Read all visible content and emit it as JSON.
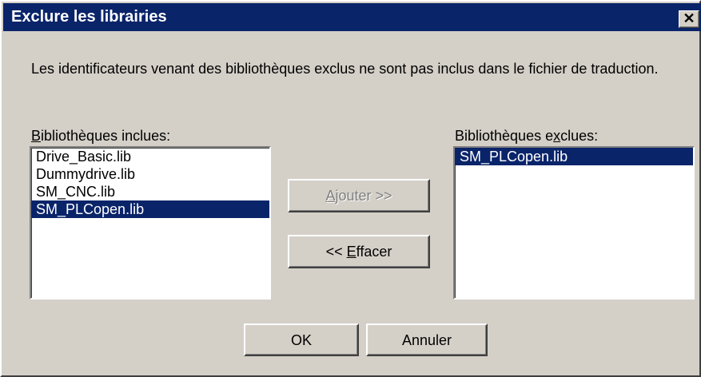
{
  "window": {
    "title": "Exclure les librairies",
    "close_glyph": "✕"
  },
  "description": "Les identificateurs venant des bibliothèques exclus ne sont pas inclus dans le fichier de traduction.",
  "included": {
    "label_prefix": "",
    "label_mnemonic": "B",
    "label_rest": "ibliothèques inclues:",
    "items": [
      "Drive_Basic.lib",
      "Dummydrive.lib",
      "SM_CNC.lib",
      "SM_PLCopen.lib"
    ],
    "selected": "SM_PLCopen.lib"
  },
  "excluded": {
    "label_prefix": "Bibliothèques e",
    "label_mnemonic": "x",
    "label_rest": "clues:",
    "items": [
      "SM_PLCopen.lib"
    ],
    "selected": "SM_PLCopen.lib"
  },
  "buttons": {
    "add": {
      "prefix": "",
      "mnemonic": "A",
      "rest": "jouter >>",
      "disabled": true
    },
    "remove": {
      "prefix": "<< ",
      "mnemonic": "E",
      "rest": "ffacer",
      "disabled": false
    },
    "ok": "OK",
    "cancel": "Annuler"
  },
  "colors": {
    "titlebar": "#0a246a",
    "face": "#d4d0c8",
    "selection": "#0a246a"
  }
}
